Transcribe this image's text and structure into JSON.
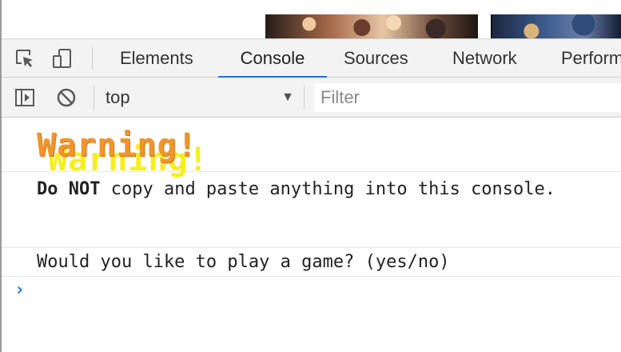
{
  "devtools": {
    "tabs": [
      {
        "label": "Elements"
      },
      {
        "label": "Console"
      },
      {
        "label": "Sources"
      },
      {
        "label": "Network"
      },
      {
        "label": "Perform"
      }
    ],
    "active_tab": "Console",
    "accent_color": "#1a73e8"
  },
  "toolbar": {
    "context": "top",
    "filter_placeholder": "Filter"
  },
  "console": {
    "warning": "Warning!",
    "warning_color": "#f0952a",
    "warning_shadow_color": "#f7ee1c",
    "message_bold": "Do NOT",
    "message_rest": " copy and paste anything into this console.",
    "question": "Would you like to play a game? (yes/no)",
    "prompt_symbol": "›"
  },
  "icons": [
    "inspect-element-icon",
    "device-toolbar-icon",
    "console-sidebar-icon",
    "clear-console-icon",
    "dropdown-caret-icon",
    "prompt-caret-icon"
  ]
}
